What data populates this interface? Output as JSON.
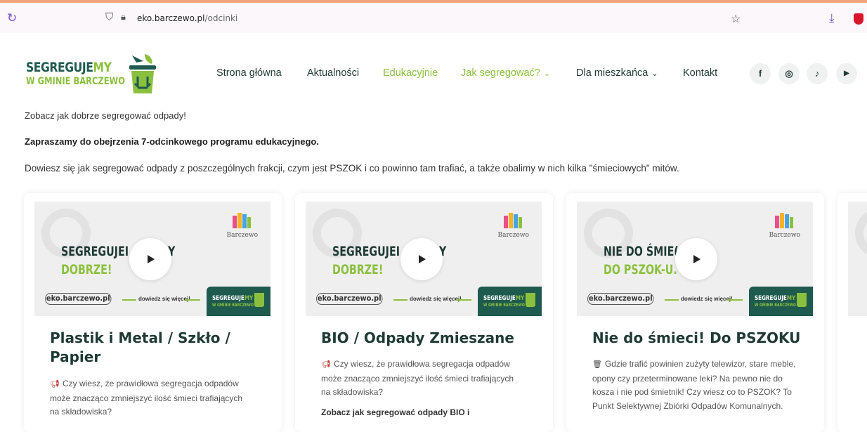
{
  "browser": {
    "url_host": "eko.barczewo.pl",
    "url_path": "/odcinki"
  },
  "logo": {
    "line1_a": "SEGREGUJE",
    "line1_b": "MY",
    "line2": "W GMINIE BARCZEWO"
  },
  "nav": {
    "items": [
      {
        "label": "Strona główna",
        "active": false,
        "dropdown": false
      },
      {
        "label": "Aktualności",
        "active": false,
        "dropdown": false
      },
      {
        "label": "Edukacyjnie",
        "active": true,
        "dropdown": false
      },
      {
        "label": "Jak segregować?",
        "active": true,
        "dropdown": true
      },
      {
        "label": "Dla mieszkańca",
        "active": false,
        "dropdown": true
      },
      {
        "label": "Kontakt",
        "active": false,
        "dropdown": false
      }
    ],
    "social": [
      "f",
      "◎",
      "♪",
      "▶"
    ]
  },
  "intro": {
    "p1": "Zobacz jak dobrze segregować odpady!",
    "p2": "Zapraszamy do obejrzenia 7-odcinkowego programu edukacyjnego.",
    "p3": "Dowiesz się jak segregować odpady z poszczególnych frakcji, czym jest PSZOK i co powinno tam trafiać, a także obalimy w nich kilka \"śmieciowych\" mitów."
  },
  "cards": [
    {
      "thumb_line1": "SEGREGUJEMY ODPADY",
      "thumb_line1_visible": "SEGREGUJEI            ADY",
      "thumb_line2": "DOBRZE!",
      "thumb_brand": "Barczewo",
      "thumb_site": "eko.barczewo.pl",
      "thumb_cta": "dowiedz się więcej!",
      "thumb_mini_a": "SEGREGUJE",
      "thumb_mini_b": "MY",
      "thumb_mini_c": "W GMINIE BARCZEWO",
      "title": "Plastik i Metal / Szkło / Papier",
      "desc": "Czy wiesz, że prawidłowa segregacja odpadów może znacząco zmniejszyć ilość śmieci trafiających na składowiska?",
      "desc2": ""
    },
    {
      "thumb_line1": "SEGREGUJEMY ODPADY",
      "thumb_line1_visible": "SEGREGUJEI            ADY",
      "thumb_line2": "DOBRZE!",
      "thumb_brand": "Barczewo",
      "thumb_site": "eko.barczewo.pl",
      "thumb_cta": "dowiedz się więcej!",
      "thumb_mini_a": "SEGREGUJE",
      "thumb_mini_b": "MY",
      "thumb_mini_c": "W GMINIE BARCZEWO",
      "title": "BIO / Odpady Zmieszane",
      "desc": "Czy wiesz, że prawidłowa segregacja odpadów może znacząco zmniejszyć ilość śmieci trafiających na składowiska?",
      "desc2": "Zobacz jak segregować odpady BIO i"
    },
    {
      "thumb_line1": "NIE DO ŚMIECI",
      "thumb_line1_visible": "NIE DO ŚMIE(",
      "thumb_line2": "DO PSZOK-U.",
      "thumb_brand": "Barczewo",
      "thumb_site": "eko.barczewo.pl",
      "thumb_cta": "dowiedz się więcej!",
      "thumb_mini_a": "SEGREGUJE",
      "thumb_mini_b": "MY",
      "thumb_mini_c": "W GMINIE BARCZEWO",
      "title": "Nie do śmieci! Do PSZOKU",
      "desc": "Gdzie trafić powinien zużyty telewizor, stare meble, opony czy przeterminowane leki? Na pewno nie do kosza i nie pod śmietnik! Czy wiesz co to PSZOK? To Punkt Selektywnej Zbiórki Odpadów Komunalnych.",
      "desc2": ""
    }
  ],
  "colors": {
    "brand_dark": "#1f5a4e",
    "brand_green": "#8bc03e",
    "nav_text": "#1f3a35"
  }
}
